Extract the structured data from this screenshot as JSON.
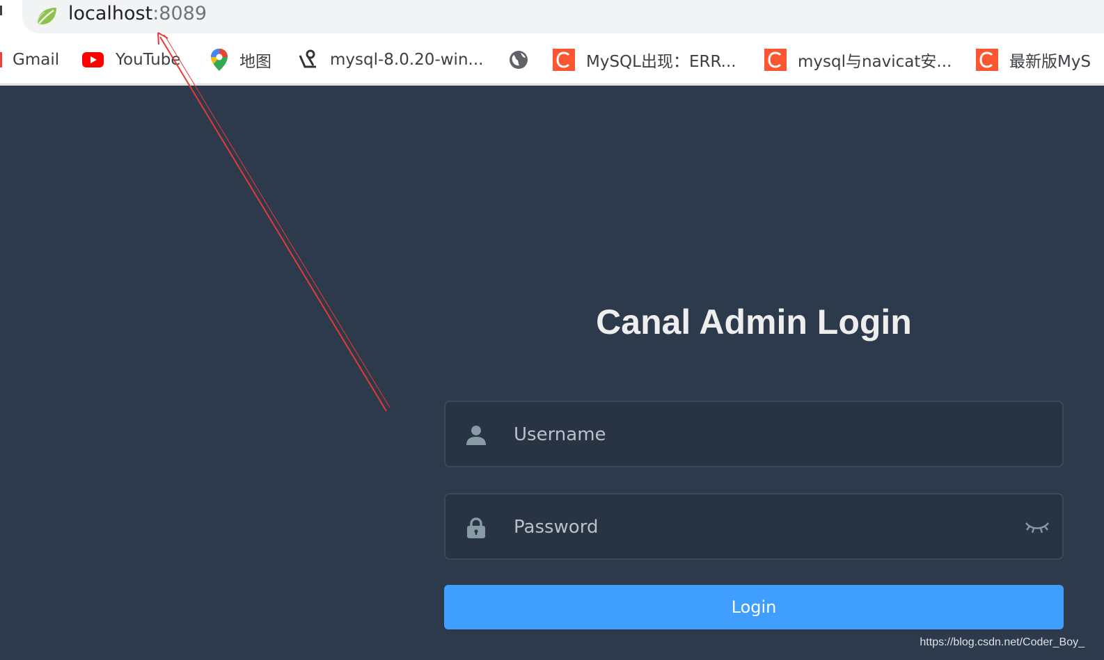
{
  "browser": {
    "url_host": "localhost",
    "url_port": ":8089",
    "bookmarks": [
      {
        "label": "Gmail",
        "icon": "gmail-icon"
      },
      {
        "label": "YouTube",
        "icon": "youtube-icon"
      },
      {
        "label": "地图",
        "icon": "maps-pin-icon"
      },
      {
        "label": "mysql-8.0.20-win...",
        "icon": "bookmark-site-icon"
      },
      {
        "label": "",
        "icon": "globe-icon"
      },
      {
        "label": "MySQL出现：ERR...",
        "icon": "csdn-c-icon"
      },
      {
        "label": "mysql与navicat安...",
        "icon": "csdn-c-icon"
      },
      {
        "label": "最新版MyS",
        "icon": "csdn-c-icon"
      }
    ]
  },
  "login": {
    "title": "Canal Admin Login",
    "username_placeholder": "Username",
    "password_placeholder": "Password",
    "login_label": "Login"
  },
  "watermark": "https://blog.csdn.net/Coder_Boy_",
  "colors": {
    "page_bg": "#2d3a4b",
    "field_bg": "#283443",
    "accent": "#409eff",
    "csdn": "#fc5531",
    "annotation": "#e53935"
  }
}
